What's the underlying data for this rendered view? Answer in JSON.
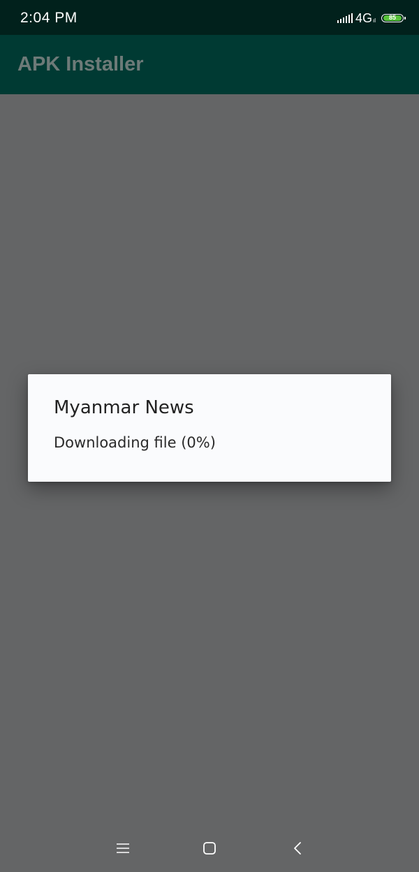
{
  "status_bar": {
    "time": "2:04 PM",
    "network": "4G",
    "network_sub": "ıl",
    "battery_level": "85",
    "battery_color": "#57c23a"
  },
  "app_bar": {
    "title": "APK Installer"
  },
  "dialog": {
    "title": "Myanmar News",
    "message": "Downloading file (0%)",
    "progress_percent": 0
  },
  "nav_bar": {
    "menu_icon": "menu-icon",
    "home_icon": "home-icon",
    "back_icon": "back-icon"
  },
  "colors": {
    "status_bar_bg": "#01211c",
    "app_bar_bg": "#003a33",
    "scrim": "#646566",
    "dialog_bg": "#fafbfd"
  }
}
